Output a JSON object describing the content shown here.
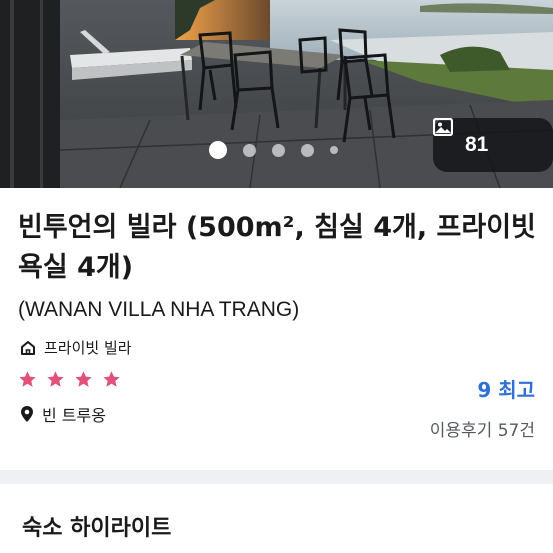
{
  "gallery": {
    "photo_count": "81",
    "dots": [
      {
        "state": "active"
      },
      {
        "state": "normal"
      },
      {
        "state": "normal"
      },
      {
        "state": "normal"
      },
      {
        "state": "small"
      }
    ],
    "icon": "image-icon"
  },
  "listing": {
    "title": "빈투언의 빌라 (500m², 침실 4개, 프라이빗 욕실 4개)",
    "subtitle": "(WANAN VILLA NHA TRANG)",
    "type_label": "프라이빗 빌라",
    "type_icon": "home-icon",
    "star_count": 4,
    "star_color": "#e0527a",
    "location": "빈 트루옹",
    "location_icon": "map-pin-icon"
  },
  "rating": {
    "score_label": "9 최고",
    "score_color": "#2f6fd6",
    "reviews_label": "이용후기 57건"
  },
  "highlights": {
    "section_title": "숙소 하이라이트"
  }
}
